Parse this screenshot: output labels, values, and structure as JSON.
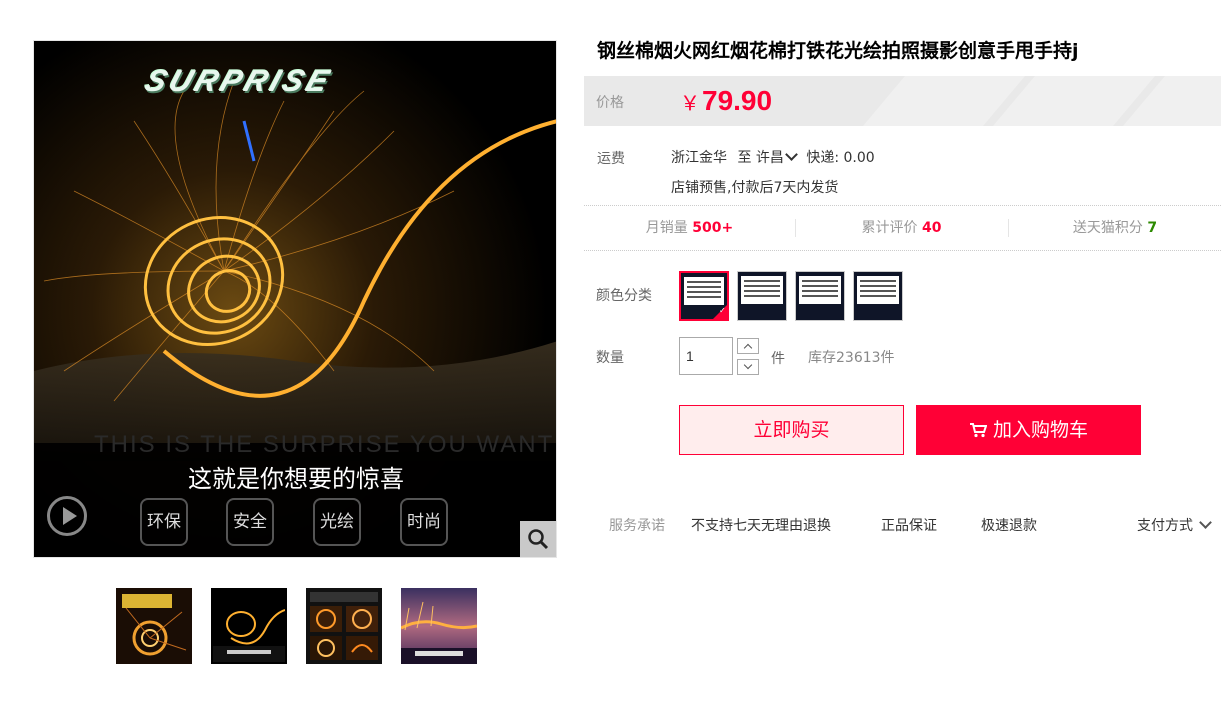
{
  "gallery": {
    "logo_text": "SURPRISE",
    "ghost_text": "THIS IS THE SURPRISE YOU WANT",
    "slogan": "这就是你想要的惊喜",
    "tags": [
      "环保",
      "安全",
      "光绘",
      "时尚"
    ],
    "thumbnails": [
      "缩略图1",
      "缩略图2",
      "缩略图3",
      "缩略图4"
    ],
    "active_thumbnail": 1
  },
  "product": {
    "title": "钢丝棉烟火网红烟花棉打铁花光绘拍照摄影创意手甩手持j",
    "price_label": "价格",
    "currency": "￥",
    "price": "79.90"
  },
  "shipping": {
    "label": "运费",
    "origin": "浙江金华",
    "to": "至",
    "destination": "许昌",
    "express": "快递: 0.00",
    "note": "店铺预售,付款后7天内发货"
  },
  "stats": {
    "monthly_sales_label": "月销量",
    "monthly_sales": "500+",
    "reviews_label": "累计评价",
    "reviews": "40",
    "points_label": "送天猫积分",
    "points": "7"
  },
  "options": {
    "color_label": "颜色分类",
    "selected_index": 0
  },
  "quantity": {
    "label": "数量",
    "value": "1",
    "unit": "件",
    "stock": "库存23613件"
  },
  "actions": {
    "buy_now": "立即购买",
    "add_to_cart": "加入购物车"
  },
  "services": {
    "label": "服务承诺",
    "items": [
      "不支持七天无理由退换",
      "正品保证",
      "极速退款"
    ],
    "payment": "支付方式"
  },
  "colors": {
    "accent": "#ff0036",
    "price_bg": "#e9e9e9",
    "points_green": "#2c8a00"
  }
}
